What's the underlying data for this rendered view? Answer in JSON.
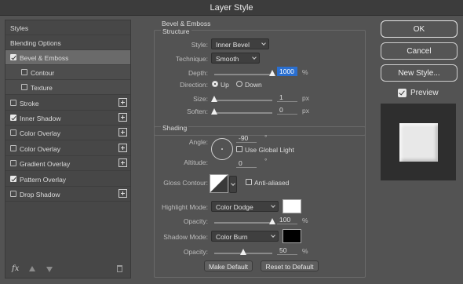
{
  "window": {
    "title": "Layer Style"
  },
  "left_panel": {
    "header": "Styles",
    "items": [
      {
        "label": "Blending Options",
        "type": "plain"
      },
      {
        "label": "Bevel & Emboss",
        "type": "check",
        "checked": true,
        "selected": true,
        "plus": false
      },
      {
        "label": "Contour",
        "type": "sub",
        "checked": false
      },
      {
        "label": "Texture",
        "type": "sub",
        "checked": false
      },
      {
        "label": "Stroke",
        "type": "check",
        "checked": false,
        "plus": true
      },
      {
        "label": "Inner Shadow",
        "type": "check",
        "checked": true,
        "plus": true
      },
      {
        "label": "Color Overlay",
        "type": "check",
        "checked": false,
        "plus": true
      },
      {
        "label": "Color Overlay",
        "type": "check",
        "checked": false,
        "plus": true
      },
      {
        "label": "Gradient Overlay",
        "type": "check",
        "checked": false,
        "plus": true
      },
      {
        "label": "Pattern Overlay",
        "type": "check",
        "checked": true,
        "plus": false
      },
      {
        "label": "Drop Shadow",
        "type": "check",
        "checked": false,
        "plus": true
      }
    ],
    "footer_fx": "fx"
  },
  "bevel": {
    "section_title": "Bevel & Emboss",
    "structure_title": "Structure",
    "style_label": "Style:",
    "style_value": "Inner Bevel",
    "technique_label": "Technique:",
    "technique_value": "Smooth",
    "depth_label": "Depth:",
    "depth_value": "1000",
    "depth_unit": "%",
    "depth_level": 1.0,
    "direction_label": "Direction:",
    "direction_up": "Up",
    "direction_down": "Down",
    "direction_selected": "Up",
    "size_label": "Size:",
    "size_value": "1",
    "size_unit": "px",
    "size_level": 0.0,
    "soften_label": "Soften:",
    "soften_value": "0",
    "soften_unit": "px",
    "soften_level": 0.0
  },
  "shading": {
    "title": "Shading",
    "angle_label": "Angle:",
    "angle_value": "-90",
    "angle_unit": "°",
    "global_light_label": "Use Global Light",
    "global_light_checked": false,
    "altitude_label": "Altitude:",
    "altitude_value": "0",
    "altitude_unit": "°",
    "gloss_label": "Gloss Contour:",
    "anti_aliased_label": "Anti-aliased",
    "anti_aliased_checked": false,
    "highlight_mode_label": "Highlight Mode:",
    "highlight_mode_value": "Color Dodge",
    "highlight_color": "#ffffff",
    "highlight_opacity_label": "Opacity:",
    "highlight_opacity_value": "100",
    "highlight_opacity_unit": "%",
    "highlight_opacity_level": 1.0,
    "shadow_mode_label": "Shadow Mode:",
    "shadow_mode_value": "Color Burn",
    "shadow_color": "#000000",
    "shadow_opacity_label": "Opacity:",
    "shadow_opacity_value": "50",
    "shadow_opacity_unit": "%",
    "shadow_opacity_level": 0.5
  },
  "buttons": {
    "make_default": "Make Default",
    "reset_default": "Reset to Default",
    "ok": "OK",
    "cancel": "Cancel",
    "new_style": "New Style...",
    "preview_label": "Preview",
    "preview_checked": true
  }
}
